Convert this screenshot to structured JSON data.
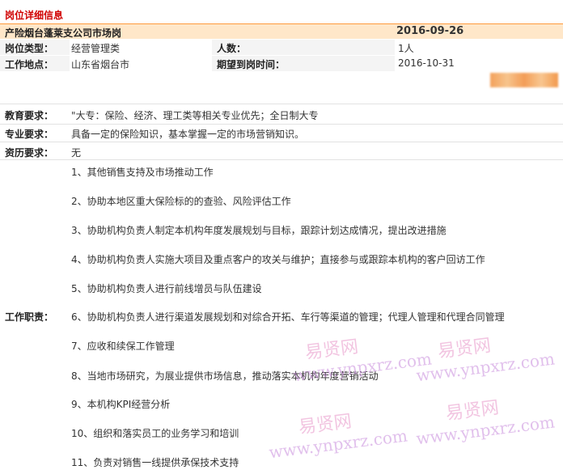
{
  "section_title": "岗位详细信息",
  "header": {
    "job_title": "产险烟台蓬莱支公司市场岗",
    "date": "2016-09-26"
  },
  "info": {
    "type_label": "岗位类型：",
    "type_value": "经营管理类",
    "count_label": "人数：",
    "count_value": "1人",
    "location_label": "工作地点：",
    "location_value": "山东省烟台市",
    "arrival_label": "期望到岗时间：",
    "arrival_value": "2016-10-31"
  },
  "requirements": {
    "education_label": "教育要求：",
    "education_value": "\"大专：保险、经济、理工类等相关专业优先；全日制大专",
    "major_label": "专业要求：",
    "major_value": "具备一定的保险知识，基本掌握一定的市场营销知识。",
    "experience_label": "资历要求：",
    "experience_value": "无"
  },
  "duties_label": "工作职责：",
  "duties": [
    "1、其他销售支持及市场推动工作",
    "2、协助本地区重大保险标的的查验、风险评估工作",
    "3、协助机构负责人制定本机构年度发展规划与目标，跟踪计划达成情况，提出改进措施",
    "4、协助机构负责人实施大项目及重点客户的攻关与维护；直接参与或跟踪本机构的客户回访工作",
    "5、协助机构负责人进行前线增员与队伍建设",
    "6、协助机构负责人进行渠道发展规划和对综合开拓、车行等渠道的管理；代理人管理和代理合同管理",
    "7、应收和续保工作管理",
    "8、当地市场研究，为展业提供市场信息，推动落实本机构年度营销活动",
    "9、本机构KPI经营分析",
    "10、组织和落实员工的业务学习和培训",
    "11、负责对销售一线提供承保技术支持"
  ],
  "watermark": {
    "cn": "易贤网",
    "en": "www.ynpxrz.com"
  }
}
